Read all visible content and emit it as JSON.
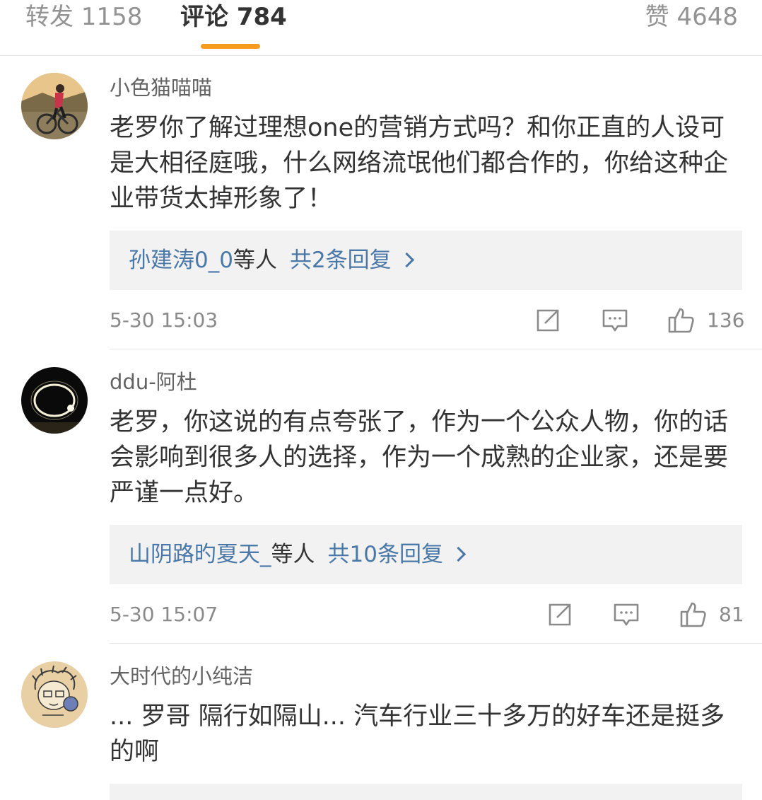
{
  "tabs": {
    "repost": "转发 1158",
    "comment": "评论 784",
    "like": "赞 4648"
  },
  "colors": {
    "accent": "#f79b1c",
    "link": "#4a78a8",
    "muted": "#8a8a8a"
  },
  "comments": [
    {
      "username": "小色猫喵喵",
      "text": "老罗你了解过理想one的营销方式吗？和你正直的人设可是大相径庭哦，什么网络流氓他们都合作的，你给这种企业带货太掉形象了！",
      "reply_users": "孙建涛0_0",
      "reply_sep": "等人",
      "reply_count": "共2条回复",
      "time": "5-30 15:03",
      "likes": "136"
    },
    {
      "username": "ddu-阿杜",
      "text": "老罗，你这说的有点夸张了，作为一个公众人物，你的话会影响到很多人的选择，作为一个成熟的企业家，还是要严谨一点好。",
      "reply_users": "山阴路旳夏天_",
      "reply_sep": "等人",
      "reply_count": "共10条回复",
      "time": "5-30 15:07",
      "likes": "81"
    },
    {
      "username": "大时代的小纯洁",
      "text": "... 罗哥 隔行如隔山... 汽车行业三十多万的好车还是挺多的啊"
    }
  ]
}
